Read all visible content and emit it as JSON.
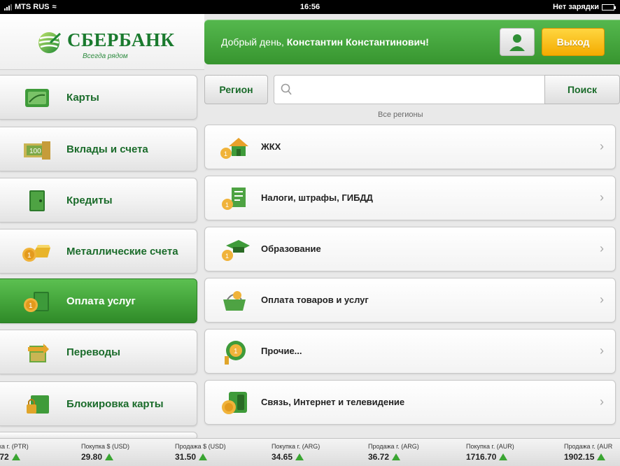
{
  "status_bar": {
    "carrier": "MTS RUS",
    "time": "16:56",
    "battery_text": "Нет зарядки"
  },
  "brand": {
    "name": "СБЕРБАНК",
    "tagline": "Всегда рядом",
    "color": "#1a7a2e"
  },
  "header": {
    "greeting": "Добрый день,",
    "user_name": "Константин Константинович!",
    "exit_label": "Выход"
  },
  "sidebar": {
    "active_index": 4,
    "items": [
      {
        "label": "Карты",
        "icon": "cards-icon"
      },
      {
        "label": "Вклады и счета",
        "icon": "deposits-icon"
      },
      {
        "label": "Кредиты",
        "icon": "credits-icon"
      },
      {
        "label": "Металлические счета",
        "icon": "metal-accounts-icon"
      },
      {
        "label": "Оплата услуг",
        "icon": "payment-icon"
      },
      {
        "label": "Переводы",
        "icon": "transfers-icon"
      },
      {
        "label": "Блокировка карты",
        "icon": "card-lock-icon"
      }
    ]
  },
  "search": {
    "region_label": "Регион",
    "placeholder": "",
    "button_label": "Поиск",
    "region_note": "Все регионы"
  },
  "categories": [
    {
      "label": "ЖКХ",
      "icon": "house-icon"
    },
    {
      "label": "Налоги, штрафы, ГИБДД",
      "icon": "taxes-icon"
    },
    {
      "label": "Образование",
      "icon": "education-icon"
    },
    {
      "label": "Оплата товаров и услуг",
      "icon": "shopping-basket-icon"
    },
    {
      "label": "Прочие...",
      "icon": "other-icon"
    },
    {
      "label": "Связь, Интернет и телевидение",
      "icon": "phone-icon"
    }
  ],
  "ticker": [
    {
      "label": "жа г. (PTR)",
      "value": ".72"
    },
    {
      "label": "Покупка $ (USD)",
      "value": "29.80"
    },
    {
      "label": "Продажа $ (USD)",
      "value": "31.50"
    },
    {
      "label": "Покупка г. (ARG)",
      "value": "34.65"
    },
    {
      "label": "Продажа г. (ARG)",
      "value": "36.72"
    },
    {
      "label": "Покупка г. (AUR)",
      "value": "1716.70"
    },
    {
      "label": "Продажа г. (AUR",
      "value": "1902.15"
    }
  ],
  "colors": {
    "accent_green": "#45a63c",
    "exit_yellow": "#f4ab00",
    "trend_up": "#3aa532"
  }
}
